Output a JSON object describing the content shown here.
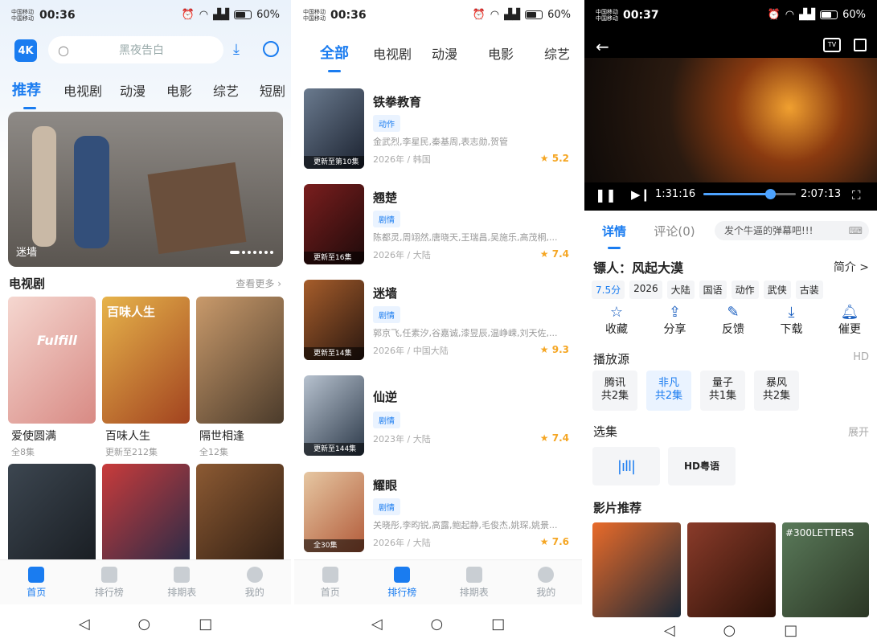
{
  "status": [
    {
      "carrier1": "中国移动",
      "carrier2": "中国移动",
      "time": "00:36",
      "battery": "60%"
    },
    {
      "carrier1": "中国移动",
      "carrier2": "中国移动",
      "time": "00:36",
      "battery": "60%"
    },
    {
      "carrier1": "中国移动",
      "carrier2": "中国移动",
      "time": "00:37",
      "battery": "60%"
    }
  ],
  "home": {
    "logo": "4K",
    "search_placeholder": "黑夜告白",
    "tabs": [
      "推荐",
      "电视剧",
      "动漫",
      "电影",
      "综艺",
      "短剧"
    ],
    "banner_title": "迷墙",
    "section_title": "电视剧",
    "section_more": "查看更多 ›",
    "cards": [
      {
        "title": "爱使圆满",
        "sub": "全8集",
        "poster_text": "Fulfill"
      },
      {
        "title": "百味人生",
        "sub": "更新至212集",
        "poster_text": "百味人生"
      },
      {
        "title": "隔世相逢",
        "sub": "全12集",
        "poster_text": ""
      }
    ]
  },
  "rank": {
    "tabs": [
      "全部",
      "电视剧",
      "动漫",
      "电影",
      "综艺"
    ],
    "items": [
      {
        "title": "铁拳教育",
        "tag": "动作",
        "cast": "金武烈,李星民,秦基周,表志勋,贺管",
        "meta": "2026年 / 韩国",
        "score": "★ 5.2",
        "badge": "更新至第10集"
      },
      {
        "title": "翘楚",
        "tag": "剧情",
        "cast": "陈都灵,周翊然,唐晓天,王瑞昌,吴施乐,高茂桐,...",
        "meta": "2026年 / 大陆",
        "score": "★ 7.4",
        "badge": "更新至16集"
      },
      {
        "title": "迷墙",
        "tag": "剧情",
        "cast": "郭京飞,任素汐,谷嘉诚,漆昱辰,温峥嵘,刘天佐,...",
        "meta": "2026年 / 中国大陆",
        "score": "★ 9.3",
        "badge": "更新至14集"
      },
      {
        "title": "仙逆",
        "tag": "剧情",
        "cast": "",
        "meta": "2023年 / 大陆",
        "score": "★ 7.4",
        "badge": "更新至144集"
      },
      {
        "title": "耀眼",
        "tag": "剧情",
        "cast": "关晓彤,李昀锐,高露,鲍起静,毛俊杰,姚琛,姚景...",
        "meta": "2026年 / 大陆",
        "score": "★ 7.6",
        "badge": "全30集"
      }
    ]
  },
  "nav": [
    "首页",
    "排行榜",
    "排期表",
    "我的"
  ],
  "detail": {
    "time_current": "1:31:16",
    "time_total": "2:07:13",
    "progress": 0.72,
    "tabs": [
      "详情",
      "评论(0)"
    ],
    "danmaku_placeholder": "发个牛逼的弹幕吧!!!",
    "title": "镖人：风起大漠",
    "intro_link": "简介 >",
    "tags": [
      "7.5分",
      "2026",
      "大陆",
      "国语",
      "动作",
      "武侠",
      "古装"
    ],
    "actions": [
      {
        "label": "收藏",
        "icon": "star-icon"
      },
      {
        "label": "分享",
        "icon": "share-icon"
      },
      {
        "label": "反馈",
        "icon": "edit-icon"
      },
      {
        "label": "下载",
        "icon": "download-icon"
      },
      {
        "label": "催更",
        "icon": "bell-icon"
      }
    ],
    "source_title": "播放源",
    "source_quality": "HD",
    "sources": [
      {
        "name": "腾讯",
        "count": "共2集"
      },
      {
        "name": "非凡",
        "count": "共2集"
      },
      {
        "name": "量子",
        "count": "共1集"
      },
      {
        "name": "暴风",
        "count": "共2集"
      }
    ],
    "episodes_title": "选集",
    "episodes_expand": "展开",
    "episodes": [
      "HD粤语"
    ],
    "rec_title": "影片推荐",
    "rec_poster_text": "#300LETTERS"
  },
  "colors": {
    "accent": "#1a7cf0",
    "score": "#f5a623",
    "tag_bg": "#eaf3ff"
  }
}
